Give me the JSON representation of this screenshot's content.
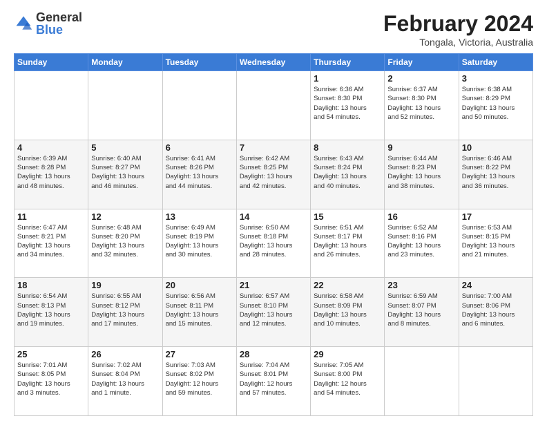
{
  "logo": {
    "general": "General",
    "blue": "Blue"
  },
  "header": {
    "month": "February 2024",
    "location": "Tongala, Victoria, Australia"
  },
  "weekdays": [
    "Sunday",
    "Monday",
    "Tuesday",
    "Wednesday",
    "Thursday",
    "Friday",
    "Saturday"
  ],
  "weeks": [
    [
      {
        "day": "",
        "info": ""
      },
      {
        "day": "",
        "info": ""
      },
      {
        "day": "",
        "info": ""
      },
      {
        "day": "",
        "info": ""
      },
      {
        "day": "1",
        "info": "Sunrise: 6:36 AM\nSunset: 8:30 PM\nDaylight: 13 hours\nand 54 minutes."
      },
      {
        "day": "2",
        "info": "Sunrise: 6:37 AM\nSunset: 8:30 PM\nDaylight: 13 hours\nand 52 minutes."
      },
      {
        "day": "3",
        "info": "Sunrise: 6:38 AM\nSunset: 8:29 PM\nDaylight: 13 hours\nand 50 minutes."
      }
    ],
    [
      {
        "day": "4",
        "info": "Sunrise: 6:39 AM\nSunset: 8:28 PM\nDaylight: 13 hours\nand 48 minutes."
      },
      {
        "day": "5",
        "info": "Sunrise: 6:40 AM\nSunset: 8:27 PM\nDaylight: 13 hours\nand 46 minutes."
      },
      {
        "day": "6",
        "info": "Sunrise: 6:41 AM\nSunset: 8:26 PM\nDaylight: 13 hours\nand 44 minutes."
      },
      {
        "day": "7",
        "info": "Sunrise: 6:42 AM\nSunset: 8:25 PM\nDaylight: 13 hours\nand 42 minutes."
      },
      {
        "day": "8",
        "info": "Sunrise: 6:43 AM\nSunset: 8:24 PM\nDaylight: 13 hours\nand 40 minutes."
      },
      {
        "day": "9",
        "info": "Sunrise: 6:44 AM\nSunset: 8:23 PM\nDaylight: 13 hours\nand 38 minutes."
      },
      {
        "day": "10",
        "info": "Sunrise: 6:46 AM\nSunset: 8:22 PM\nDaylight: 13 hours\nand 36 minutes."
      }
    ],
    [
      {
        "day": "11",
        "info": "Sunrise: 6:47 AM\nSunset: 8:21 PM\nDaylight: 13 hours\nand 34 minutes."
      },
      {
        "day": "12",
        "info": "Sunrise: 6:48 AM\nSunset: 8:20 PM\nDaylight: 13 hours\nand 32 minutes."
      },
      {
        "day": "13",
        "info": "Sunrise: 6:49 AM\nSunset: 8:19 PM\nDaylight: 13 hours\nand 30 minutes."
      },
      {
        "day": "14",
        "info": "Sunrise: 6:50 AM\nSunset: 8:18 PM\nDaylight: 13 hours\nand 28 minutes."
      },
      {
        "day": "15",
        "info": "Sunrise: 6:51 AM\nSunset: 8:17 PM\nDaylight: 13 hours\nand 26 minutes."
      },
      {
        "day": "16",
        "info": "Sunrise: 6:52 AM\nSunset: 8:16 PM\nDaylight: 13 hours\nand 23 minutes."
      },
      {
        "day": "17",
        "info": "Sunrise: 6:53 AM\nSunset: 8:15 PM\nDaylight: 13 hours\nand 21 minutes."
      }
    ],
    [
      {
        "day": "18",
        "info": "Sunrise: 6:54 AM\nSunset: 8:13 PM\nDaylight: 13 hours\nand 19 minutes."
      },
      {
        "day": "19",
        "info": "Sunrise: 6:55 AM\nSunset: 8:12 PM\nDaylight: 13 hours\nand 17 minutes."
      },
      {
        "day": "20",
        "info": "Sunrise: 6:56 AM\nSunset: 8:11 PM\nDaylight: 13 hours\nand 15 minutes."
      },
      {
        "day": "21",
        "info": "Sunrise: 6:57 AM\nSunset: 8:10 PM\nDaylight: 13 hours\nand 12 minutes."
      },
      {
        "day": "22",
        "info": "Sunrise: 6:58 AM\nSunset: 8:09 PM\nDaylight: 13 hours\nand 10 minutes."
      },
      {
        "day": "23",
        "info": "Sunrise: 6:59 AM\nSunset: 8:07 PM\nDaylight: 13 hours\nand 8 minutes."
      },
      {
        "day": "24",
        "info": "Sunrise: 7:00 AM\nSunset: 8:06 PM\nDaylight: 13 hours\nand 6 minutes."
      }
    ],
    [
      {
        "day": "25",
        "info": "Sunrise: 7:01 AM\nSunset: 8:05 PM\nDaylight: 13 hours\nand 3 minutes."
      },
      {
        "day": "26",
        "info": "Sunrise: 7:02 AM\nSunset: 8:04 PM\nDaylight: 13 hours\nand 1 minute."
      },
      {
        "day": "27",
        "info": "Sunrise: 7:03 AM\nSunset: 8:02 PM\nDaylight: 12 hours\nand 59 minutes."
      },
      {
        "day": "28",
        "info": "Sunrise: 7:04 AM\nSunset: 8:01 PM\nDaylight: 12 hours\nand 57 minutes."
      },
      {
        "day": "29",
        "info": "Sunrise: 7:05 AM\nSunset: 8:00 PM\nDaylight: 12 hours\nand 54 minutes."
      },
      {
        "day": "",
        "info": ""
      },
      {
        "day": "",
        "info": ""
      }
    ]
  ]
}
